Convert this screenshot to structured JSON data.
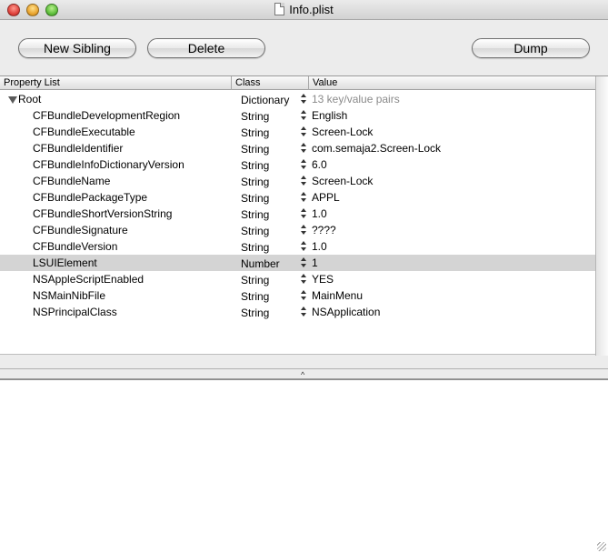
{
  "window": {
    "title": "Info.plist"
  },
  "toolbar": {
    "new_sibling_label": "New Sibling",
    "delete_label": "Delete",
    "dump_label": "Dump"
  },
  "table": {
    "columns": [
      "Property List",
      "Class",
      "Value"
    ],
    "root": {
      "name": "Root",
      "class": "Dictionary",
      "value": "13 key/value pairs",
      "expanded": true
    },
    "rows": [
      {
        "name": "CFBundleDevelopmentRegion",
        "class": "String",
        "value": "English"
      },
      {
        "name": "CFBundleExecutable",
        "class": "String",
        "value": "Screen-Lock"
      },
      {
        "name": "CFBundleIdentifier",
        "class": "String",
        "value": "com.semaja2.Screen-Lock"
      },
      {
        "name": "CFBundleInfoDictionaryVersion",
        "class": "String",
        "value": "6.0"
      },
      {
        "name": "CFBundleName",
        "class": "String",
        "value": "Screen-Lock"
      },
      {
        "name": "CFBundlePackageType",
        "class": "String",
        "value": "APPL"
      },
      {
        "name": "CFBundleShortVersionString",
        "class": "String",
        "value": "1.0"
      },
      {
        "name": "CFBundleSignature",
        "class": "String",
        "value": "????"
      },
      {
        "name": "CFBundleVersion",
        "class": "String",
        "value": "1.0"
      },
      {
        "name": "LSUIElement",
        "class": "Number",
        "value": "1",
        "selected": true
      },
      {
        "name": "NSAppleScriptEnabled",
        "class": "String",
        "value": "YES"
      },
      {
        "name": "NSMainNibFile",
        "class": "String",
        "value": "MainMenu"
      },
      {
        "name": "NSPrincipalClass",
        "class": "String",
        "value": "NSApplication"
      }
    ]
  },
  "splitter": {
    "handle_glyph": "^"
  },
  "text_pane": {
    "content": ""
  },
  "colors": {
    "selection": "#d4d4d4",
    "muted_text": "#8a8a8a",
    "window_bg": "#ececec"
  }
}
